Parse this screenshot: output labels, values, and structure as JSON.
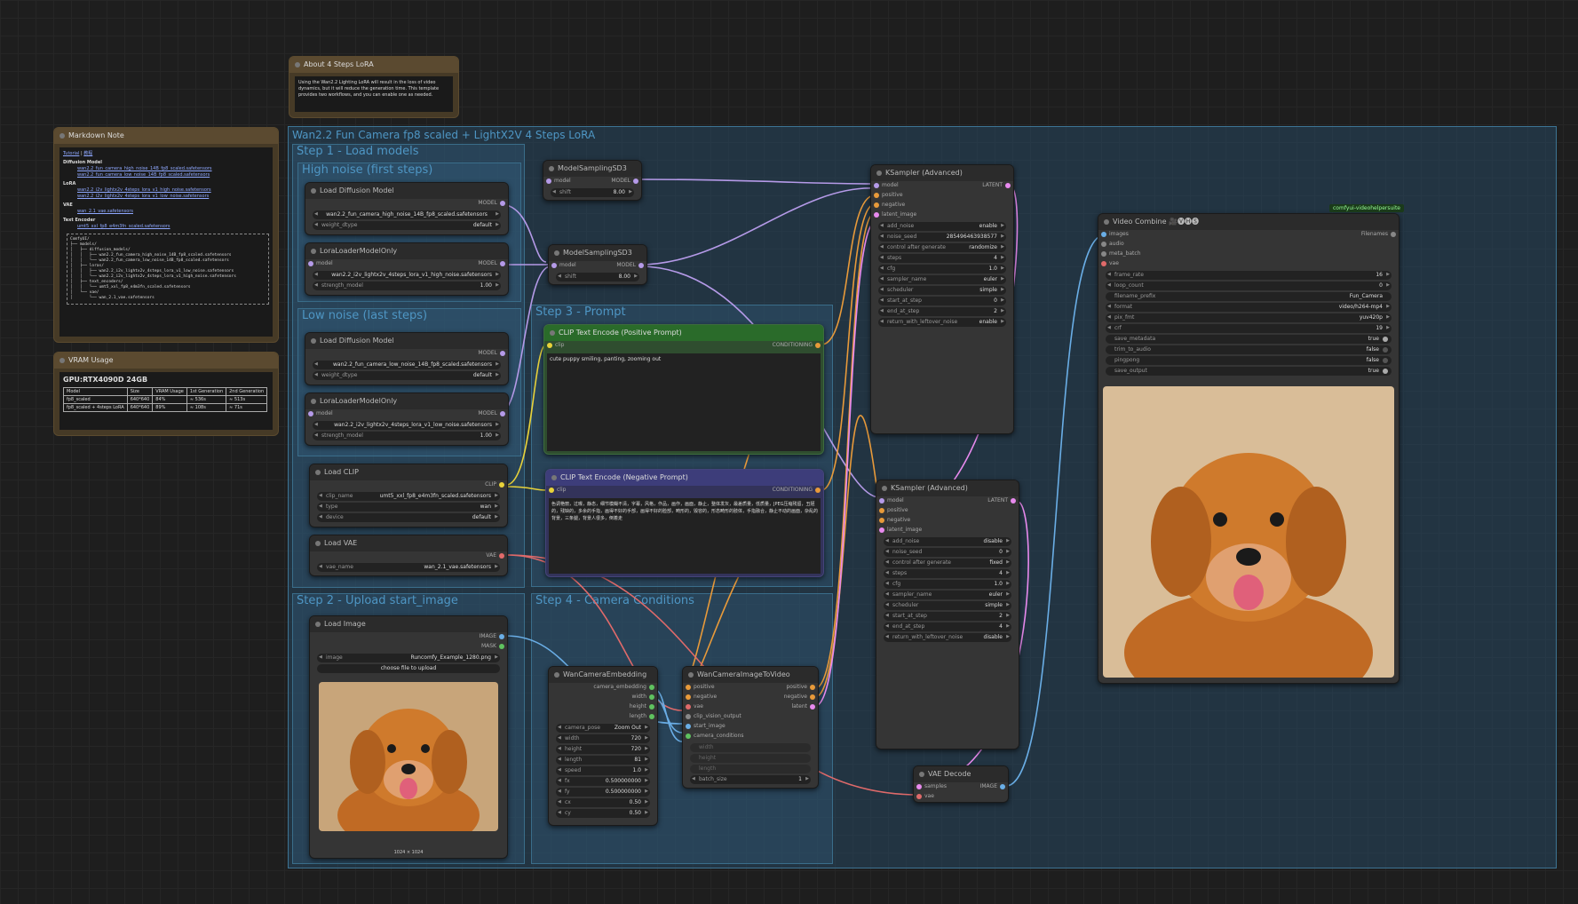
{
  "groups": {
    "main": "Wan2.2 Fun Camera fp8 scaled + LightX2V 4 Steps LoRA",
    "step1": "Step 1 - Load models",
    "high": "High noise (first steps)",
    "low": "Low noise (last steps)",
    "step2": "Step 2 - Upload start_image",
    "step3": "Step 3 - Prompt",
    "step4": "Step 4 - Camera Conditions"
  },
  "about_note": {
    "title": "About 4 Steps LoRA",
    "text": "Using the Wan2.2 Lighting LoRA will result in the loss of video dynamics, but it will reduce the generation time. This template provides two workflows, and you can enable one as needed."
  },
  "markdown_note": {
    "title": "Markdown Note",
    "tabs": [
      "Tutorial",
      "教程"
    ],
    "sections": {
      "diffusion": "Diffusion Model",
      "lora": "LoRA",
      "vae": "VAE",
      "text_encoder": "Text Encoder"
    },
    "files": {
      "d1": "wan2.2_fun_camera_high_noise_14B_fp8_scaled.safetensors",
      "d2": "wan2.2_fun_camera_low_noise_14B_fp8_scaled.safetensors",
      "l1": "wan2.2_i2v_lightx2v_4steps_lora_v1_high_noise.safetensors",
      "l2": "wan2.2_i2v_lightx2v_4steps_lora_v1_low_noise.safetensors",
      "v1": "wan_2.1_vae.safetensors",
      "t1": "umt5_xxl_fp8_e4m3fn_scaled.safetensors"
    },
    "tree": "ComfyUI/\n├── models/\n│   ├── diffusion_models/\n│   │   ├── wan2.2_fun_camera_high_noise_14B_fp8_scaled.safetensors\n│   │   └── wan2.2_fun_camera_low_noise_14B_fp8_scaled.safetensors\n│   ├── loras/\n│   │   ├── wan2.2_i2v_lightx2v_4steps_lora_v1_low_noise.safetensors\n│   │   └── wan2.2_i2v_lightx2v_4steps_lora_v1_high_noise.safetensors\n│   ├── text_encoders/\n│   │   └── umt5_xxl_fp8_e4m3fn_scaled.safetensors\n│   └── vae/\n│       └── wan_2.1_vae.safetensors"
  },
  "vram": {
    "title": "VRAM Usage",
    "gpu": "GPU:RTX4090D 24GB",
    "headers": [
      "Model",
      "Size",
      "VRAM Usage",
      "1st Generation",
      "2nd Generation"
    ],
    "rows": [
      [
        "fp8_scaled",
        "640*640",
        "84%",
        "≈ 536s",
        "≈ 513s"
      ],
      [
        "fp8_scaled + 4steps LoRA",
        "640*640",
        "89%",
        "≈ 108s",
        "≈ 71s"
      ]
    ]
  },
  "nodes": {
    "ldm_high": {
      "title": "Load Diffusion Model",
      "out": "MODEL",
      "unet": "wan2.2_fun_camera_high_noise_14B_fp8_scaled.safetensors",
      "dtype_label": "weight_dtype",
      "dtype": "default"
    },
    "lora_high": {
      "title": "LoraLoaderModelOnly",
      "in": "model",
      "out": "MODEL",
      "name": "wan2.2_i2v_lightx2v_4steps_lora_v1_high_noise.safetensors",
      "strength_label": "strength_model",
      "strength": "1.00"
    },
    "ldm_low": {
      "title": "Load Diffusion Model",
      "out": "MODEL",
      "unet": "wan2.2_fun_camera_low_noise_14B_fp8_scaled.safetensors",
      "dtype_label": "weight_dtype",
      "dtype": "default"
    },
    "lora_low": {
      "title": "LoraLoaderModelOnly",
      "in": "model",
      "out": "MODEL",
      "name": "wan2.2_i2v_lightx2v_4steps_lora_v1_low_noise.safetensors",
      "strength_label": "strength_model",
      "strength": "1.00"
    },
    "clip": {
      "title": "Load CLIP",
      "out": "CLIP",
      "name_label": "clip_name",
      "name": "umt5_xxl_fp8_e4m3fn_scaled.safetensors",
      "type_label": "type",
      "type": "wan",
      "device_label": "device",
      "device": "default"
    },
    "vae": {
      "title": "Load VAE",
      "out": "VAE",
      "name_label": "vae_name",
      "name": "wan_2.1_vae.safetensors"
    },
    "msd1": {
      "title": "ModelSamplingSD3",
      "in": "model",
      "out": "MODEL",
      "shift_label": "shift",
      "shift": "8.00"
    },
    "msd2": {
      "title": "ModelSamplingSD3",
      "in": "model",
      "out": "MODEL",
      "shift_label": "shift",
      "shift": "8.00"
    },
    "pos": {
      "title": "CLIP Text Encode (Positive Prompt)",
      "in": "clip",
      "out": "CONDITIONING",
      "text": "cute puppy smiling, panting, zooming out"
    },
    "neg": {
      "title": "CLIP Text Encode (Negative Prompt)",
      "in": "clip",
      "out": "CONDITIONING",
      "text": "色调艳丽，过曝，静态，细节模糊不清，字幕，风格，作品，画作，画面，静止，整体发灰，最差质量，低质量，JPEG压缩残留，丑陋的，残缺的，多余的手指，画得不好的手部，画得不好的脸部，畸形的，毁容的，形态畸形的肢体，手指融合，静止不动的画面，杂乱的背景，三条腿，背景人很多，倒着走"
    },
    "loadimg": {
      "title": "Load Image",
      "out1": "IMAGE",
      "out2": "MASK",
      "image_label": "image",
      "image": "Runcomfy_Example_1280.png",
      "upload": "choose file to upload",
      "caption": "1024 × 1024"
    },
    "ks1": {
      "title": "KSampler (Advanced)",
      "ins": [
        "model",
        "positive",
        "negative",
        "latent_image"
      ],
      "out": "LATENT",
      "widgets": [
        [
          "add_noise",
          "enable"
        ],
        [
          "noise_seed",
          "285496463938577"
        ],
        [
          "control after generate",
          "randomize"
        ],
        [
          "steps",
          "4"
        ],
        [
          "cfg",
          "1.0"
        ],
        [
          "sampler_name",
          "euler"
        ],
        [
          "scheduler",
          "simple"
        ],
        [
          "start_at_step",
          "0"
        ],
        [
          "end_at_step",
          "2"
        ],
        [
          "return_with_leftover_noise",
          "enable"
        ]
      ]
    },
    "ks2": {
      "title": "KSampler (Advanced)",
      "ins": [
        "model",
        "positive",
        "negative",
        "latent_image"
      ],
      "out": "LATENT",
      "widgets": [
        [
          "add_noise",
          "disable"
        ],
        [
          "noise_seed",
          "0"
        ],
        [
          "control after generate",
          "fixed"
        ],
        [
          "steps",
          "4"
        ],
        [
          "cfg",
          "1.0"
        ],
        [
          "sampler_name",
          "euler"
        ],
        [
          "scheduler",
          "simple"
        ],
        [
          "start_at_step",
          "2"
        ],
        [
          "end_at_step",
          "4"
        ],
        [
          "return_with_leftover_noise",
          "disable"
        ]
      ]
    },
    "wce": {
      "title": "WanCameraEmbedding",
      "outs": [
        "camera_embedding",
        "width",
        "height",
        "length"
      ],
      "widgets": [
        [
          "camera_pose",
          "Zoom Out"
        ],
        [
          "width",
          "720"
        ],
        [
          "height",
          "720"
        ],
        [
          "length",
          "81"
        ],
        [
          "speed",
          "1.0"
        ],
        [
          "fx",
          "0.500000000"
        ],
        [
          "fy",
          "0.500000000"
        ],
        [
          "cx",
          "0.50"
        ],
        [
          "cy",
          "0.50"
        ]
      ]
    },
    "wci": {
      "title": "WanCameraImageToVideo",
      "ins": [
        "positive",
        "negative",
        "vae",
        "clip_vision_output",
        "start_image",
        "camera_conditions",
        "width",
        "height",
        "length"
      ],
      "outs": [
        "positive",
        "negative",
        "latent"
      ],
      "batch_label": "batch_size",
      "batch": "1"
    },
    "vaedec": {
      "title": "VAE Decode",
      "ins": [
        "samples",
        "vae"
      ],
      "out": "IMAGE"
    },
    "vc": {
      "title": "Video Combine 🎥🅥🅗🅢",
      "badge": "comfyui-videohelpersuite",
      "ins": [
        "images",
        "audio",
        "meta_batch",
        "vae"
      ],
      "out": "Filenames",
      "widgets": [
        [
          "frame_rate",
          "16"
        ],
        [
          "loop_count",
          "0"
        ],
        [
          "filename_prefix",
          "Fun_Camera"
        ],
        [
          "format",
          "video/h264-mp4"
        ],
        [
          "pix_fmt",
          "yuv420p"
        ],
        [
          "crf",
          "19"
        ]
      ],
      "toggles": [
        [
          "save_metadata",
          "true"
        ],
        [
          "trim_to_audio",
          "false"
        ],
        [
          "pingpong",
          "false"
        ],
        [
          "save_output",
          "true"
        ]
      ]
    }
  },
  "colors": {
    "group": "#336180",
    "positive": "#2f4d2f",
    "negative": "#33335a",
    "note": "#5b4a30"
  }
}
